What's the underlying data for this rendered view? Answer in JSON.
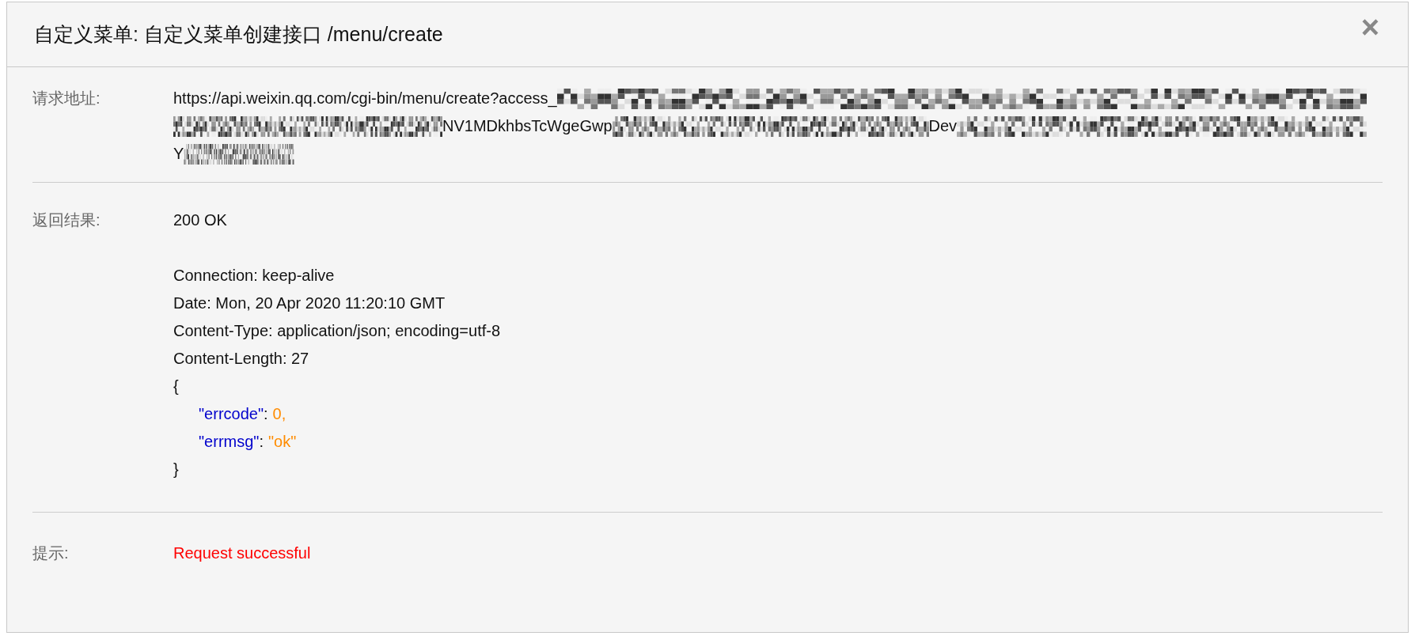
{
  "dialog": {
    "title": "自定义菜单: 自定义菜单创建接口 /menu/create",
    "close_icon": "×"
  },
  "rows": [
    {
      "kind": "url",
      "label": "请求地址:",
      "lines": [
        [
          {
            "kind": "text",
            "text": "https://api.weixin.qq.com/cgi-bin/menu/create?access_"
          },
          {
            "kind": "redacted"
          }
        ],
        [
          {
            "kind": "redacted"
          },
          {
            "kind": "text",
            "text": "NV1MDkhbsTcWgeGwp"
          },
          {
            "kind": "redacted"
          },
          {
            "kind": "text",
            "text": "Dev"
          },
          {
            "kind": "redacted"
          }
        ],
        [
          {
            "kind": "text",
            "text": "Y"
          },
          {
            "kind": "redacted"
          }
        ]
      ]
    },
    {
      "kind": "response",
      "label": "返回结果:",
      "status": "200 OK",
      "headers": [
        "Connection: keep-alive",
        "Date: Mon, 20 Apr 2020 11:20:10 GMT",
        "Content-Type: application/json; encoding=utf-8",
        "Content-Length: 27"
      ],
      "body": {
        "open": "{",
        "separator": ":",
        "fields": [
          {
            "key": "\"errcode\"",
            "value": "0,"
          },
          {
            "key": "\"errmsg\"",
            "value": "\"ok\""
          }
        ],
        "close": "}"
      }
    },
    {
      "kind": "hint",
      "label": "提示:",
      "message": "Request successful"
    }
  ]
}
